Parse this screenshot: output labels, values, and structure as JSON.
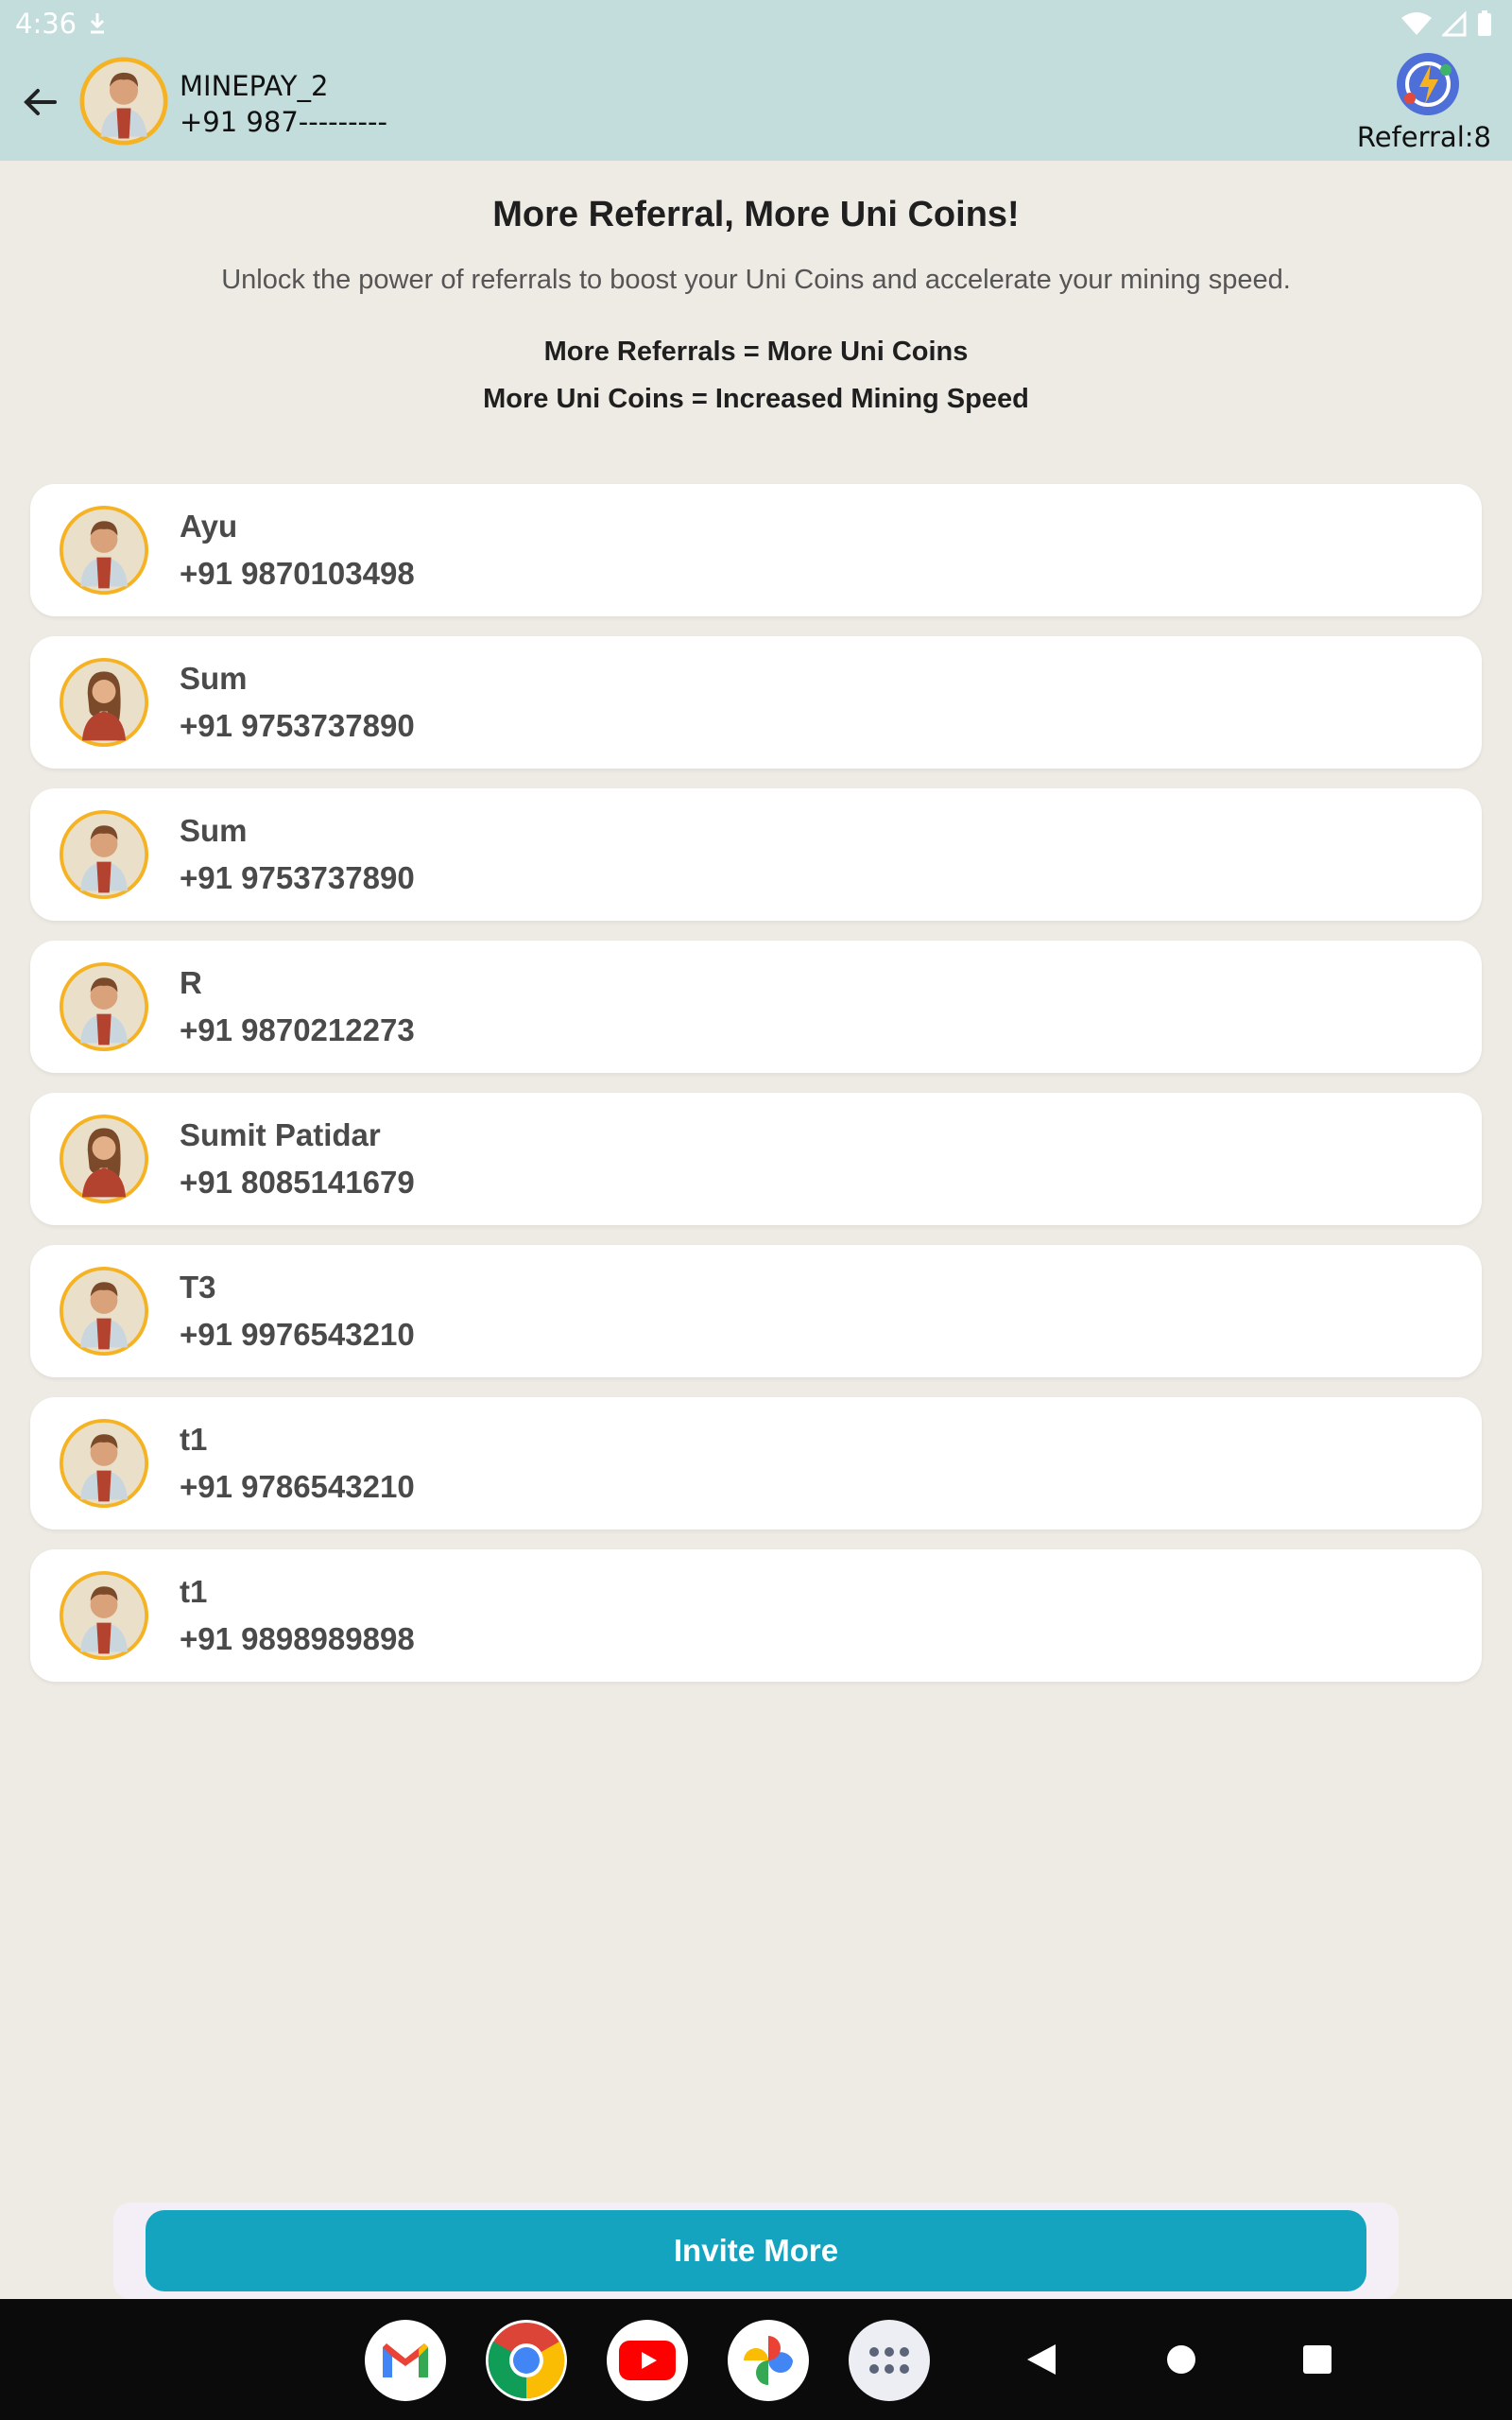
{
  "status_bar": {
    "time": "4:36"
  },
  "header": {
    "name": "MINEPAY_2",
    "phone": "+91 987---------",
    "referral_label": "Referral:8"
  },
  "intro": {
    "title": "More Referral, More Uni Coins!",
    "subtitle": "Unlock the power of referrals to boost your Uni Coins and accelerate your mining speed.",
    "line1": "More Referrals = More Uni Coins",
    "line2": "More Uni Coins = Increased Mining Speed"
  },
  "referrals": [
    {
      "name": "Ayu",
      "phone": "+91 9870103498",
      "avatar": "male-avatar"
    },
    {
      "name": "Sum",
      "phone": "+91 9753737890",
      "avatar": "female-avatar"
    },
    {
      "name": "Sum",
      "phone": "+91 9753737890",
      "avatar": "male-avatar"
    },
    {
      "name": "R",
      "phone": "+91 9870212273",
      "avatar": "male-avatar"
    },
    {
      "name": "Sumit Patidar",
      "phone": "+91 8085141679",
      "avatar": "female-avatar"
    },
    {
      "name": "T3",
      "phone": "+91 9976543210",
      "avatar": "male-avatar"
    },
    {
      "name": "t1",
      "phone": "+91 9786543210",
      "avatar": "male-avatar"
    },
    {
      "name": "t1",
      "phone": "+91 9898989898",
      "avatar": "male-avatar"
    }
  ],
  "invite": {
    "label": "Invite More"
  },
  "colors": {
    "accent": "#14a4bf",
    "header_bg": "#c3dcdc",
    "page_bg": "#eeeae4",
    "avatar_ring": "#f5b324"
  },
  "dock_apps": [
    "gmail-icon",
    "chrome-icon",
    "youtube-icon",
    "photos-icon",
    "app-drawer-icon"
  ],
  "nav_buttons": [
    "back-nav-icon",
    "home-nav-icon",
    "recents-nav-icon"
  ]
}
